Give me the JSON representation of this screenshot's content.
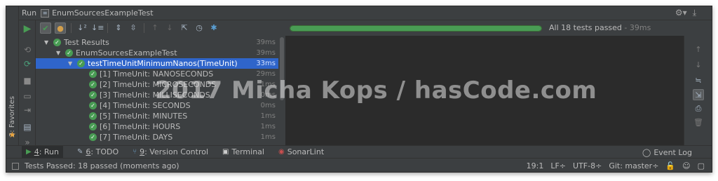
{
  "window": {
    "tool_name": "Run",
    "config_name": "EnumSourcesExampleTest"
  },
  "favorites": {
    "label": "2: Favorites"
  },
  "progress": {
    "fraction": 1.0,
    "status": "All 18 tests passed",
    "time": " - 39ms",
    "color": "#499c54"
  },
  "tree": {
    "rows": [
      {
        "label": "Test Results",
        "duration": "39ms",
        "depth": 0,
        "caret": "▼",
        "selected": false
      },
      {
        "label": "EnumSourcesExampleTest",
        "duration": "39ms",
        "depth": 1,
        "caret": "▼",
        "selected": false
      },
      {
        "label": "testTimeUnitMinimumNanos(TimeUnit)",
        "duration": "33ms",
        "depth": 2,
        "caret": "▼",
        "selected": true
      },
      {
        "label": "[1] TimeUnit: NANOSECONDS",
        "duration": "29ms",
        "depth": 3,
        "caret": "",
        "selected": false
      },
      {
        "label": "[2] TimeUnit: MICROSECONDS",
        "duration": "1ms",
        "depth": 3,
        "caret": "",
        "selected": false
      },
      {
        "label": "[3] TimeUnit: MILLISECONDS",
        "duration": "0ms",
        "depth": 3,
        "caret": "",
        "selected": false
      },
      {
        "label": "[4] TimeUnit: SECONDS",
        "duration": "0ms",
        "depth": 3,
        "caret": "",
        "selected": false
      },
      {
        "label": "[5] TimeUnit: MINUTES",
        "duration": "1ms",
        "depth": 3,
        "caret": "",
        "selected": false
      },
      {
        "label": "[6] TimeUnit: HOURS",
        "duration": "1ms",
        "depth": 3,
        "caret": "",
        "selected": false
      },
      {
        "label": "[7] TimeUnit: DAYS",
        "duration": "1ms",
        "depth": 3,
        "caret": "",
        "selected": false
      }
    ]
  },
  "watermark": "2017 Micha Kops / hasCode.com",
  "tool_tabs": [
    {
      "key": "4",
      "label": ": Run",
      "icon": "run-icon",
      "active": true
    },
    {
      "key": "6",
      "label": ": TODO",
      "icon": "todo-icon",
      "active": false
    },
    {
      "key": "9",
      "label": ": Version Control",
      "icon": "vcs-icon",
      "active": false
    },
    {
      "key": "",
      "label": "Terminal",
      "icon": "terminal-icon",
      "active": false
    },
    {
      "key": "",
      "label": "SonarLint",
      "icon": "sonarlint-icon",
      "active": false
    }
  ],
  "event_log": "Event Log",
  "status": {
    "message": "Tests Passed: 18 passed (moments ago)",
    "position": "19:1",
    "line_sep": "LF÷",
    "encoding": "UTF-8÷",
    "vcs": "Git: master÷"
  }
}
